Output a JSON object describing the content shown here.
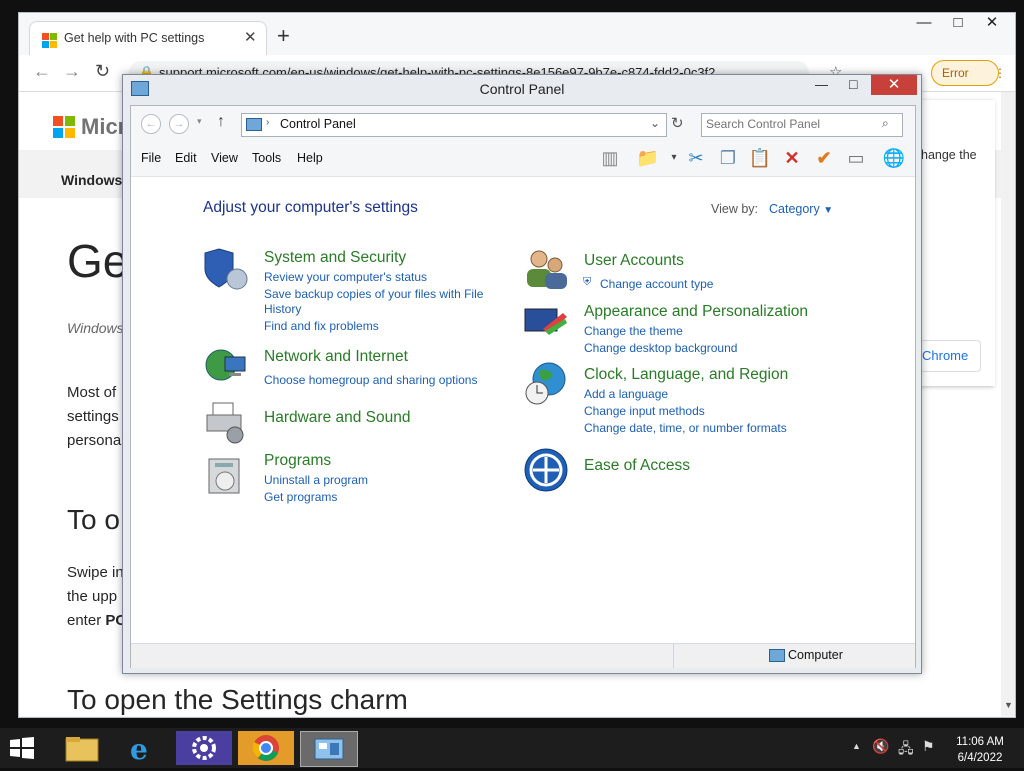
{
  "browser": {
    "tab_title": "Get help with PC settings",
    "tab_close": "✕",
    "new_tab": "+",
    "url": "support.microsoft.com/en-us/windows/get-help-with-pc-settings-8e156e97-9b7e-c874-fdd2-0c3f2",
    "error_label": "Error",
    "minimize": "—",
    "maximize": "□",
    "close": "✕",
    "collapse": "⌄"
  },
  "webpage": {
    "logo_text": "Micr",
    "nav_item": "Windows s",
    "title_fragment": "Ge",
    "subtitle_fragment": "Windows",
    "para1": [
      "Most of",
      "settings",
      "persona"
    ],
    "heading_fragment": "To o",
    "para2": [
      "Swipe in",
      "the upp",
      "enter "
    ],
    "para2_bold": "PC",
    "bottom_heading": "To open the Settings charm",
    "right_fragment": "hange the",
    "right_button": "Chrome"
  },
  "control_panel": {
    "title": "Control Panel",
    "minimize": "—",
    "maximize": "□",
    "close": "✕",
    "breadcrumb": "Control Panel",
    "search_placeholder": "Search Control Panel",
    "menu": [
      "File",
      "Edit",
      "View",
      "Tools",
      "Help"
    ],
    "heading": "Adjust your computer's settings",
    "view_by_label": "View by:",
    "view_by_value": "Category",
    "categories_left": [
      {
        "title": "System and Security",
        "links": [
          "Review your computer's status",
          "Save backup copies of your files with File",
          "History",
          "Find and fix problems"
        ]
      },
      {
        "title": "Network and Internet",
        "links": [
          "Choose homegroup and sharing options"
        ]
      },
      {
        "title": "Hardware and Sound",
        "links": []
      },
      {
        "title": "Programs",
        "links": [
          "Uninstall a program",
          "Get programs"
        ]
      }
    ],
    "categories_right": [
      {
        "title": "User Accounts",
        "links": [
          "Change account type"
        ]
      },
      {
        "title": "Appearance and Personalization",
        "links": [
          "Change the theme",
          "Change desktop background"
        ]
      },
      {
        "title": "Clock, Language, and Region",
        "links": [
          "Add a language",
          "Change input methods",
          "Change date, time, or number formats"
        ]
      },
      {
        "title": "Ease of Access",
        "links": []
      }
    ],
    "status_text": "Computer"
  },
  "taskbar": {
    "time": "11:06 AM",
    "date": "6/4/2022"
  },
  "colors": {
    "category_green": "#2a7a28",
    "link_blue": "#1e5fb0",
    "heading_blue": "#1e3287",
    "close_red": "#c7413a"
  }
}
